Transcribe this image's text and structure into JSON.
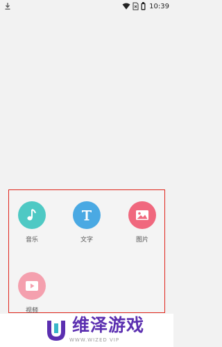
{
  "status_bar": {
    "time": "10:39",
    "icons": [
      "download-icon",
      "wifi-icon",
      "no-sim-icon",
      "battery-icon"
    ]
  },
  "picker": {
    "items": [
      {
        "label": "音乐",
        "icon": "music-note-icon",
        "color": "#4ec9c4"
      },
      {
        "label": "文字",
        "icon": "text-t-icon",
        "color": "#4aa9e3"
      },
      {
        "label": "图片",
        "icon": "image-icon",
        "color": "#f0687e"
      },
      {
        "label": "视频",
        "icon": "video-play-icon",
        "color": "#f4a0ae"
      }
    ],
    "highlight_color": "#e0251b"
  },
  "watermark": {
    "title": "维泽游戏",
    "subtitle": "WWW.WIZED VIP",
    "brand_color": "#5b2fb0"
  }
}
